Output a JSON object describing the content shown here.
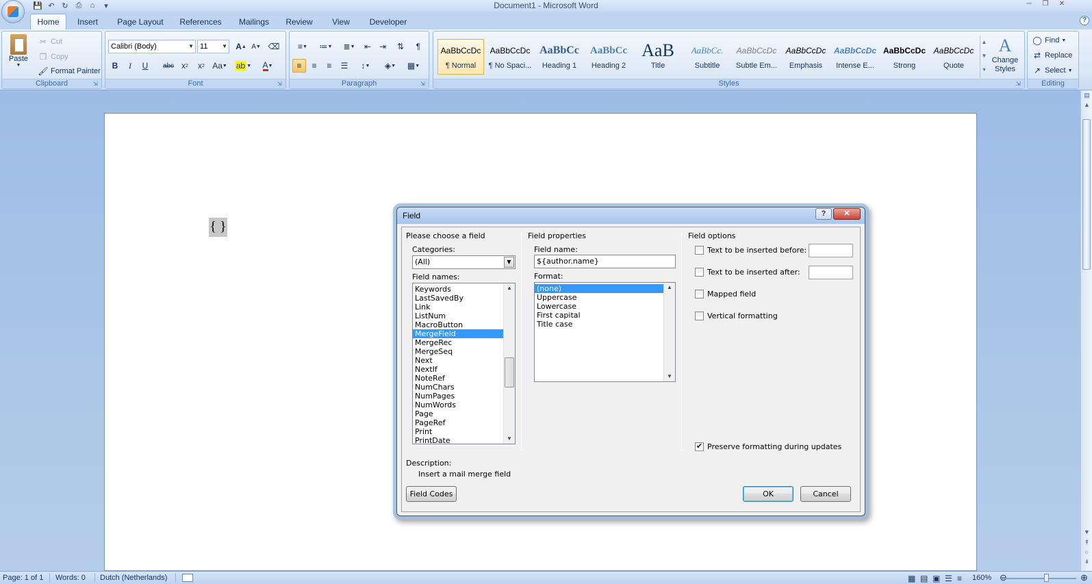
{
  "window": {
    "title": "Document1 - Microsoft Word"
  },
  "tabs": [
    "Home",
    "Insert",
    "Page Layout",
    "References",
    "Mailings",
    "Review",
    "View",
    "Developer"
  ],
  "clipboard": {
    "paste_label": "Paste",
    "cut_label": "Cut",
    "copy_label": "Copy",
    "format_painter_label": "Format Painter",
    "group_label": "Clipboard"
  },
  "font": {
    "font_name": "Calibri (Body)",
    "font_size": "11",
    "group_label": "Font"
  },
  "paragraph": {
    "group_label": "Paragraph"
  },
  "styles": {
    "group_label": "Styles",
    "items": [
      {
        "sample": "AaBbCcDc",
        "name": "¶ Normal"
      },
      {
        "sample": "AaBbCcDc",
        "name": "¶ No Spaci..."
      },
      {
        "sample": "AaBbCc",
        "name": "Heading 1"
      },
      {
        "sample": "AaBbCc",
        "name": "Heading 2"
      },
      {
        "sample": "AaB",
        "name": "Title"
      },
      {
        "sample": "AaBbCc.",
        "name": "Subtitle"
      },
      {
        "sample": "AaBbCcDc",
        "name": "Subtle Em..."
      },
      {
        "sample": "AaBbCcDc",
        "name": "Emphasis"
      },
      {
        "sample": "AaBbCcDc",
        "name": "Intense E..."
      },
      {
        "sample": "AaBbCcDc",
        "name": "Strong"
      },
      {
        "sample": "AaBbCcDc",
        "name": "Quote"
      }
    ],
    "change_styles_label": "Change Styles"
  },
  "editing": {
    "find_label": "Find",
    "replace_label": "Replace",
    "select_label": "Select",
    "group_label": "Editing"
  },
  "document": {
    "field_code_text": "{ }"
  },
  "statusbar": {
    "page": "Page: 1 of 1",
    "words": "Words: 0",
    "language": "Dutch (Netherlands)",
    "zoom": "160%"
  },
  "dialog": {
    "title": "Field",
    "choose_heading": "Please choose a field",
    "categories_label": "Categories:",
    "categories_value": "(All)",
    "field_names_label": "Field names:",
    "field_names": [
      "Keywords",
      "LastSavedBy",
      "Link",
      "ListNum",
      "MacroButton",
      "MergeField",
      "MergeRec",
      "MergeSeq",
      "Next",
      "NextIf",
      "NoteRef",
      "NumChars",
      "NumPages",
      "NumWords",
      "Page",
      "PageRef",
      "Print",
      "PrintDate"
    ],
    "selected_field_name": "MergeField",
    "properties_heading": "Field properties",
    "field_name_label": "Field name:",
    "field_name_value": "${author.name}",
    "format_label": "Format:",
    "formats": [
      "(none)",
      "Uppercase",
      "Lowercase",
      "First capital",
      "Title case"
    ],
    "selected_format": "(none)",
    "options_heading": "Field options",
    "opt_before": "Text to be inserted before:",
    "opt_after": "Text to be inserted after:",
    "opt_mapped": "Mapped field",
    "opt_vertical": "Vertical formatting",
    "preserve_label": "Preserve formatting during updates",
    "preserve_checked": true,
    "description_label": "Description:",
    "description_text": "Insert a mail merge field",
    "field_codes_button": "Field Codes",
    "ok_button": "OK",
    "cancel_button": "Cancel"
  }
}
